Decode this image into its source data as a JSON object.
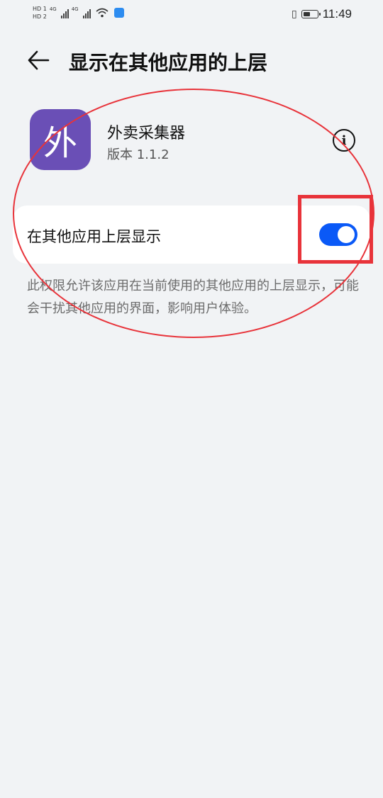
{
  "status_bar": {
    "hd1": "HD 1",
    "hd2": "HD 2",
    "net1": "4G",
    "net2": "4G",
    "time": "11:49",
    "battery_level": 0.55
  },
  "header": {
    "title": "显示在其他应用的上层"
  },
  "app": {
    "icon_char": "外",
    "name": "外卖采集器",
    "version": "版本 1.1.2",
    "icon_color": "#6a4fb6"
  },
  "setting": {
    "label": "在其他应用上层显示",
    "enabled": true,
    "toggle_color": "#0a59f7"
  },
  "description": "此权限允许该应用在当前使用的其他应用的上层显示，可能会干扰其他应用的界面，影响用户体验。",
  "annotation_color": "#e8333a"
}
